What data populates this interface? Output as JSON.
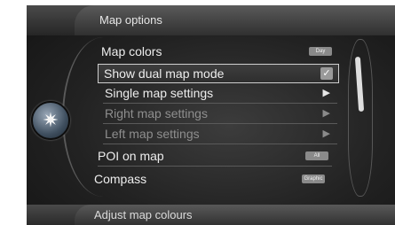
{
  "header": {
    "title": "Map options"
  },
  "menu": {
    "items": [
      {
        "label": "Map colors",
        "value": "Day"
      },
      {
        "label": "Show dual map mode",
        "value": "✓"
      },
      {
        "label": "Single map settings",
        "value": "▶"
      },
      {
        "label": "Right map settings",
        "value": "▶"
      },
      {
        "label": "Left map settings",
        "value": "▶"
      },
      {
        "label": "POI on map",
        "value": "All"
      },
      {
        "label": "Compass",
        "value": "Graphic"
      }
    ]
  },
  "footer": {
    "text": "Adjust map colours"
  },
  "icons": {
    "knob": "compass-rose-icon",
    "knob_glyph": "✷"
  },
  "colors": {
    "background": "#222222",
    "selection_border": "#cfcfcf",
    "text": "#ededed",
    "dim_text": "#8e8e8e"
  }
}
